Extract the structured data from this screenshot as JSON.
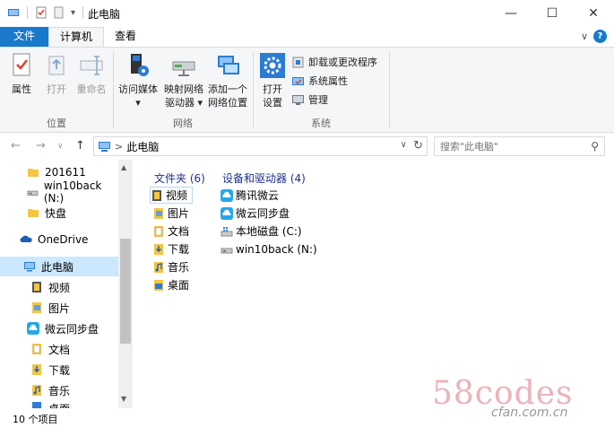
{
  "window": {
    "title": "此电脑",
    "controls": {
      "minimize": "—",
      "maximize": "☐",
      "close": "✕"
    }
  },
  "quick_access": {
    "dropdown": "▾"
  },
  "tabs": {
    "file": "文件",
    "computer": "计算机",
    "view": "查看",
    "collapse": "∨"
  },
  "ribbon": {
    "location": {
      "label": "位置",
      "properties": "属性",
      "open": "打开",
      "rename": "重命名"
    },
    "network": {
      "label": "网络",
      "access_media": [
        "访问媒体",
        "▾"
      ],
      "map_drive": [
        "映射网络",
        "驱动器 ▾"
      ],
      "add_location": [
        "添加一个",
        "网络位置"
      ]
    },
    "system": {
      "label": "系统",
      "open_settings": [
        "打开",
        "设置"
      ],
      "uninstall": "卸载或更改程序",
      "system_props": "系统属性",
      "manage": "管理"
    }
  },
  "address": {
    "back": "←",
    "forward": "→",
    "recent": "∨",
    "up": "↑",
    "path_sep": ">",
    "path": "此电脑",
    "dropdown": "∨",
    "refresh": "↻",
    "search_placeholder": "搜索\"此电脑\"",
    "search_icon": "⚲"
  },
  "nav": {
    "scroll_up": "▲",
    "scroll_down": "▼",
    "items": [
      {
        "label": "201611",
        "icon": "folder-icon"
      },
      {
        "label": "win10back (N:)",
        "icon": "usb-drive-icon"
      },
      {
        "label": "快盘",
        "icon": "folder-icon"
      },
      {
        "label": "OneDrive",
        "icon": "onedrive-icon"
      },
      {
        "label": "此电脑",
        "icon": "computer-icon"
      },
      {
        "label": "视频",
        "icon": "video-folder-icon"
      },
      {
        "label": "图片",
        "icon": "pictures-folder-icon"
      },
      {
        "label": "微云同步盘",
        "icon": "weiyun-icon"
      },
      {
        "label": "文档",
        "icon": "documents-folder-icon"
      },
      {
        "label": "下载",
        "icon": "downloads-folder-icon"
      },
      {
        "label": "音乐",
        "icon": "music-folder-icon"
      },
      {
        "label": "桌面",
        "icon": "desktop-folder-icon"
      }
    ]
  },
  "content": {
    "folders_header": "文件夹 (6)",
    "devices_header": "设备和驱动器 (4)",
    "folders": [
      "视频",
      "图片",
      "文档",
      "下载",
      "音乐",
      "桌面"
    ],
    "devices": [
      "腾讯微云",
      "微云同步盘",
      "本地磁盘 (C:)",
      "win10back (N:)"
    ]
  },
  "status": {
    "count": "10 个项目"
  },
  "watermark": {
    "main": "58codes",
    "sub": "cfan.com.cn"
  },
  "colors": {
    "accent": "#1979ca",
    "selected": "#cce8ff",
    "header": "#1e3287"
  }
}
